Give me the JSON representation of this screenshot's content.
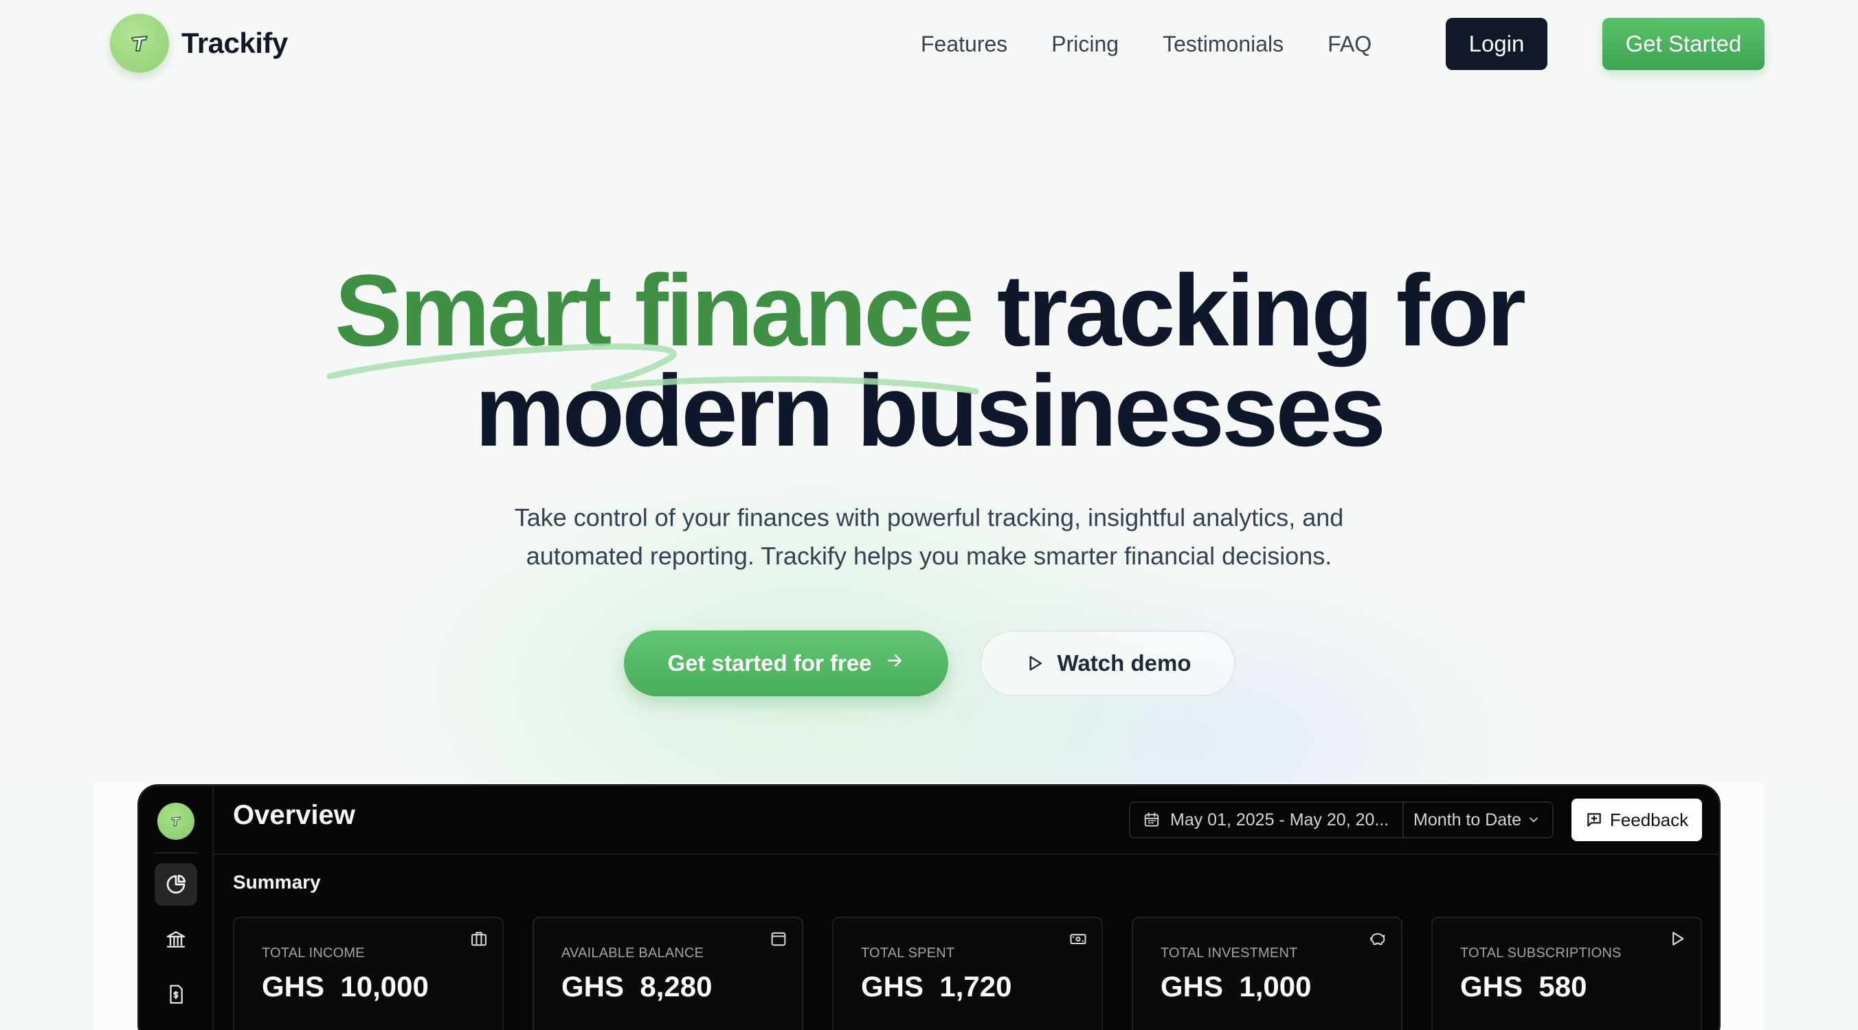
{
  "nav": {
    "brand_name": "Trackify",
    "links": [
      "Features",
      "Pricing",
      "Testimonials",
      "FAQ"
    ],
    "login_label": "Login",
    "get_started_label": "Get Started"
  },
  "hero": {
    "title_accent": "Smart finance",
    "title_rest_line1": " tracking for",
    "title_line2": "modern businesses",
    "subtitle_line1": "Take control of your finances with powerful tracking, insightful analytics, and",
    "subtitle_line2": "automated reporting. Trackify helps you make smarter financial decisions.",
    "primary_cta": "Get started for free",
    "secondary_cta": "Watch demo"
  },
  "dashboard": {
    "title": "Overview",
    "date_range": "May 01, 2025 - May 20, 20...",
    "period": "Month to Date",
    "feedback_label": "Feedback",
    "summary_label": "Summary",
    "sidebar_icons": [
      "pie-chart-icon",
      "bank-icon",
      "invoice-icon"
    ],
    "cards": [
      {
        "label": "TOTAL INCOME",
        "value": "GHS  10,000",
        "icon": "briefcase-icon"
      },
      {
        "label": "AVAILABLE BALANCE",
        "value": "GHS  8,280",
        "icon": "wallet-icon"
      },
      {
        "label": "TOTAL SPENT",
        "value": "GHS  1,720",
        "icon": "banknote-icon"
      },
      {
        "label": "TOTAL INVESTMENT",
        "value": "GHS  1,000",
        "icon": "piggy-bank-icon"
      },
      {
        "label": "TOTAL SUBSCRIPTIONS",
        "value": "GHS  580",
        "icon": "play-icon"
      }
    ]
  },
  "colors": {
    "accent_green": "#3f8f45",
    "button_green": "#4caf5c",
    "dark": "#111827",
    "dashboard_bg": "#060606"
  }
}
